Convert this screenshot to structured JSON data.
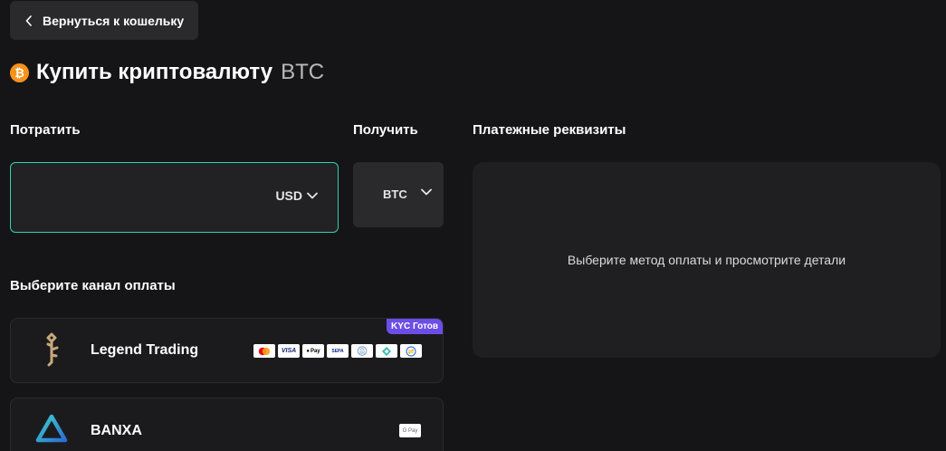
{
  "back_button": {
    "label": "Вернуться к кошельку"
  },
  "header": {
    "title": "Купить криптовалюту",
    "coin": "BTC",
    "coin_glyph": "₿"
  },
  "spend": {
    "label": "Потратить",
    "amount": "",
    "currency": "USD"
  },
  "receive": {
    "label": "Получить",
    "currency": "BTC"
  },
  "payment_details": {
    "label": "Платежные реквизиты",
    "placeholder_message": "Выберите метод оплаты и просмотрите детали"
  },
  "channels": {
    "label": "Выберите канал оплаты",
    "providers": [
      {
        "name": "Legend Trading",
        "badge": "KYC Готов",
        "logo": "legend-key-icon",
        "payment_methods": [
          {
            "icon": "mastercard-icon",
            "text": ""
          },
          {
            "icon": "visa-icon",
            "text": "VISA"
          },
          {
            "icon": "apple-pay-icon",
            "text": "Pay"
          },
          {
            "icon": "sepa-icon",
            "text": "SEPA"
          },
          {
            "icon": "bank-icon",
            "text": ""
          },
          {
            "icon": "pix-icon",
            "text": ""
          },
          {
            "icon": "transfer-icon",
            "text": ""
          }
        ]
      },
      {
        "name": "BANXA",
        "logo": "banxa-triangle-icon",
        "payment_methods": [
          {
            "icon": "google-pay-icon",
            "text": "G Pay"
          }
        ]
      }
    ]
  },
  "colors": {
    "accent": "#2fd3b0",
    "bitcoin": "#f7931a",
    "badge": "#6c4ee6",
    "background": "#151517"
  }
}
